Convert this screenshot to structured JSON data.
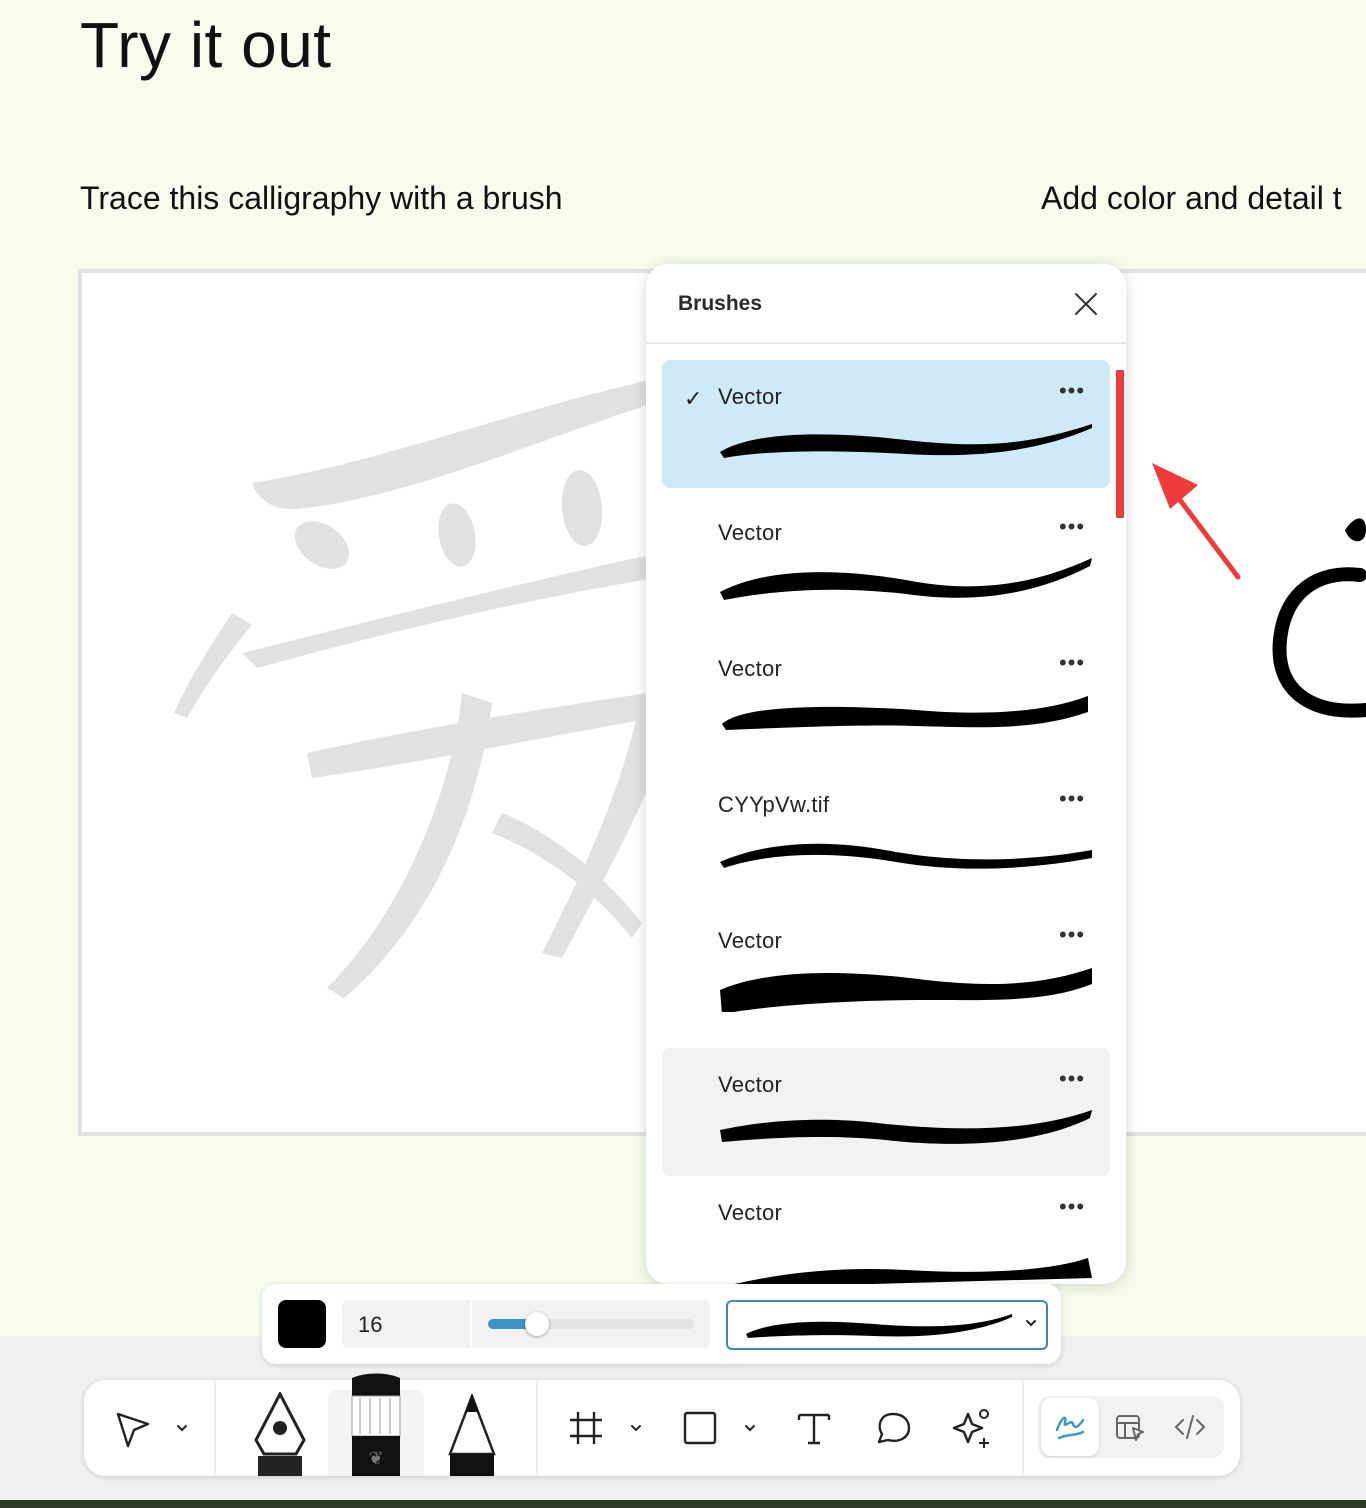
{
  "page": {
    "title": "Try it out",
    "subtitle_left": "Trace this calligraphy with a brush",
    "subtitle_right": "Add color and detail t"
  },
  "brushes_panel": {
    "title": "Brushes",
    "close_icon": "close-icon",
    "more_label": "•••",
    "check_mark": "✓",
    "items": [
      {
        "name": "Vector",
        "selected": true
      },
      {
        "name": "Vector",
        "selected": false
      },
      {
        "name": "Vector",
        "selected": false
      },
      {
        "name": "CYYpVw.tif",
        "selected": false
      },
      {
        "name": "Vector",
        "selected": false
      },
      {
        "name": "Vector",
        "selected": false,
        "hovered": true
      },
      {
        "name": "Vector",
        "selected": false
      }
    ]
  },
  "brush_bar": {
    "color": "#000000",
    "size": "16",
    "slider_fraction": 0.24,
    "accent": "#3d93c6"
  },
  "toolbar": {
    "tools": [
      "move-icon",
      "chevron-down-icon",
      "pen-tool-icon",
      "brush-tool-icon",
      "pencil-tool-icon",
      "frame-icon",
      "rectangle-icon",
      "text-icon",
      "comment-icon",
      "ai-sparkle-icon"
    ],
    "modes": [
      "draw-mode-icon",
      "design-mode-icon",
      "dev-mode-icon"
    ]
  },
  "annotation_color": "#ee3b3b"
}
